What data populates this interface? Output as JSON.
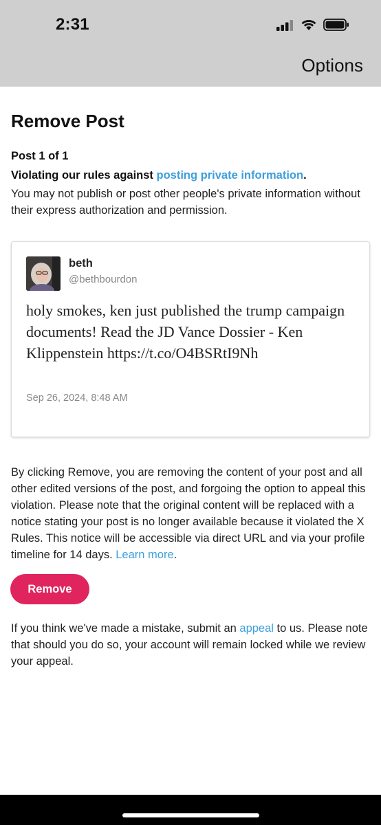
{
  "status_bar": {
    "time": "2:31"
  },
  "nav": {
    "options_label": "Options"
  },
  "page": {
    "title": "Remove Post",
    "post_count": "Post 1 of 1",
    "violation_prefix": "Violating our rules against ",
    "violation_link": "posting private information",
    "violation_suffix": ".",
    "violation_description": "You may not publish or post other people's private information without their express authorization and permission."
  },
  "tweet": {
    "name": "beth",
    "handle": "@bethbourdon",
    "body": "holy smokes, ken just published the trump campaign documents! Read the JD Vance Dossier - Ken Klippenstein https://t.co/O4BSRtI9Nh",
    "date": "Sep 26, 2024, 8:48 AM"
  },
  "explanation": {
    "text": "By clicking Remove, you are removing the content of your post and all other edited versions of the post, and forgoing the option to appeal this violation. Please note that the original content will be replaced with a notice stating your post is no longer available because it violated the X Rules. This notice will be accessible via direct URL and via your profile timeline for 14 days. ",
    "learn_more_link": "Learn more",
    "suffix": "."
  },
  "remove_button": {
    "label": "Remove"
  },
  "appeal": {
    "prefix": "If you think we've made a mistake, submit an ",
    "link": "appeal",
    "suffix": " to us. Please note that should you do so, your account will remain locked while we review your appeal."
  },
  "colors": {
    "accent_link": "#3d9fdd",
    "remove_button": "#e0245e",
    "header_bg": "#cfcfcf"
  },
  "icons": [
    "signal-icon",
    "wifi-icon",
    "battery-icon"
  ]
}
